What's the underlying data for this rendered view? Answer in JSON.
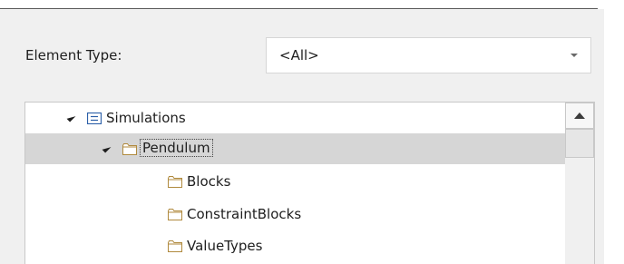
{
  "filter": {
    "label": "Element Type:",
    "selected_value": "<All>"
  },
  "tree": {
    "nodes": [
      {
        "label": "Simulations",
        "icon": "model-package-icon",
        "level": 0,
        "expanded": true,
        "selected": false
      },
      {
        "label": "Pendulum",
        "icon": "folder-icon",
        "level": 1,
        "expanded": true,
        "selected": true
      },
      {
        "label": "Blocks",
        "icon": "folder-icon",
        "level": 2,
        "expanded": false,
        "selected": false
      },
      {
        "label": "ConstraintBlocks",
        "icon": "folder-icon",
        "level": 2,
        "expanded": false,
        "selected": false
      },
      {
        "label": "ValueTypes",
        "icon": "folder-icon",
        "level": 2,
        "expanded": false,
        "selected": false
      }
    ]
  },
  "colors": {
    "panel_background": "#f0f0f0",
    "selection": "#d6d6d6",
    "folder_outline": "#b08a3e",
    "model_icon": "#2b5fa8"
  }
}
